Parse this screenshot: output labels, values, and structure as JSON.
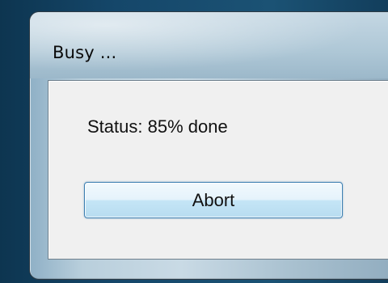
{
  "dialog": {
    "title": "Busy ...",
    "status_text": "Status: 85% done",
    "progress_percent": 85,
    "abort_label": "Abort"
  },
  "colors": {
    "desktop": "#15476a",
    "frame_glass": "#b9cfdc",
    "client_background": "#f0f0f0",
    "button_border": "#3c7fb1",
    "button_fill_top": "#e5f3fb",
    "button_fill_bottom": "#b8dcf0",
    "text": "#111111"
  }
}
